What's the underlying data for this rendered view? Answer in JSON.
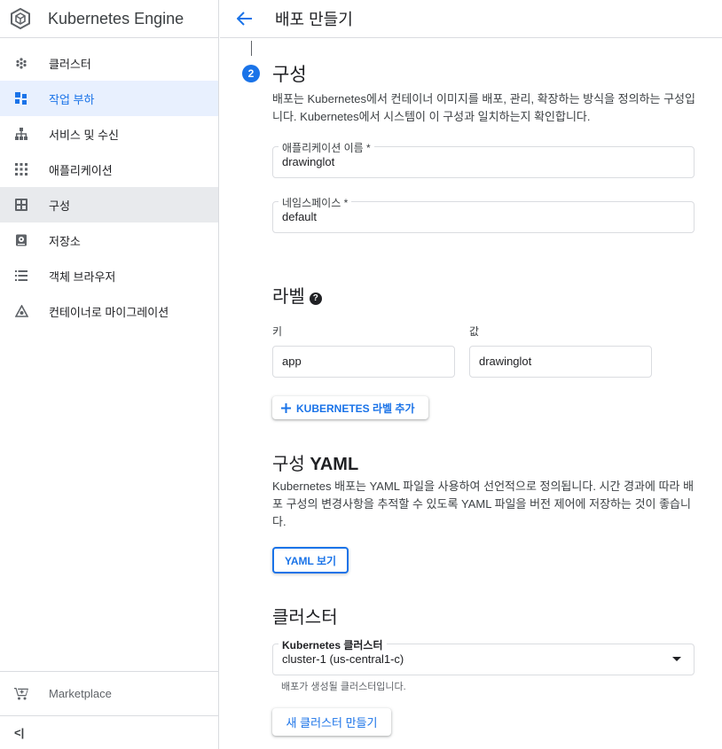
{
  "sidebar": {
    "title": "Kubernetes Engine",
    "items": [
      {
        "label": "클러스터",
        "icon": "clusters-icon"
      },
      {
        "label": "작업 부하",
        "icon": "workloads-icon"
      },
      {
        "label": "서비스 및 수신",
        "icon": "services-icon"
      },
      {
        "label": "애플리케이션",
        "icon": "applications-icon"
      },
      {
        "label": "구성",
        "icon": "configuration-icon"
      },
      {
        "label": "저장소",
        "icon": "storage-icon"
      },
      {
        "label": "객체 브라우저",
        "icon": "object-browser-icon"
      },
      {
        "label": "컨테이너로 마이그레이션",
        "icon": "migrate-icon"
      }
    ],
    "marketplace": "Marketplace",
    "collapse": "<|"
  },
  "header": {
    "title": "배포 만들기"
  },
  "step": {
    "number": "2",
    "title": "구성",
    "description": "배포는 Kubernetes에서 컨테이너 이미지를 배포, 관리, 확장하는 방식을 정의하는 구성입니다. Kubernetes에서 시스템이 이 구성과 일치하는지 확인합니다."
  },
  "form": {
    "app_name_label": "애플리케이션 이름 *",
    "app_name_value": "drawinglot",
    "namespace_label": "네임스페이스 *",
    "namespace_value": "default"
  },
  "labels_section": {
    "title": "라벨",
    "help": "?",
    "key_label": "키",
    "value_label": "값",
    "key_value": "app",
    "value_value": "drawinglot",
    "add_button": "KUBERNETES 라벨 추가"
  },
  "yaml_section": {
    "title_prefix": "구성 ",
    "title_bold": "YAML",
    "description": "Kubernetes 배포는 YAML 파일을 사용하여 선언적으로 정의됩니다. 시간 경과에 따라 배포 구성의 변경사항을 추적할 수 있도록 YAML 파일을 버전 제어에 저장하는 것이 좋습니다.",
    "view_button": "YAML 보기"
  },
  "cluster_section": {
    "title": "클러스터",
    "select_label": "Kubernetes 클러스터",
    "select_value": "cluster-1 (us-central1-c)",
    "hint": "배포가 생성될 클러스터입니다.",
    "new_cluster_button": "새 클러스터 만들기"
  },
  "colors": {
    "accent": "#1a73e8",
    "active_bg": "#e8f0fe",
    "selected_bg": "#e8eaed",
    "border": "#dadce0"
  }
}
